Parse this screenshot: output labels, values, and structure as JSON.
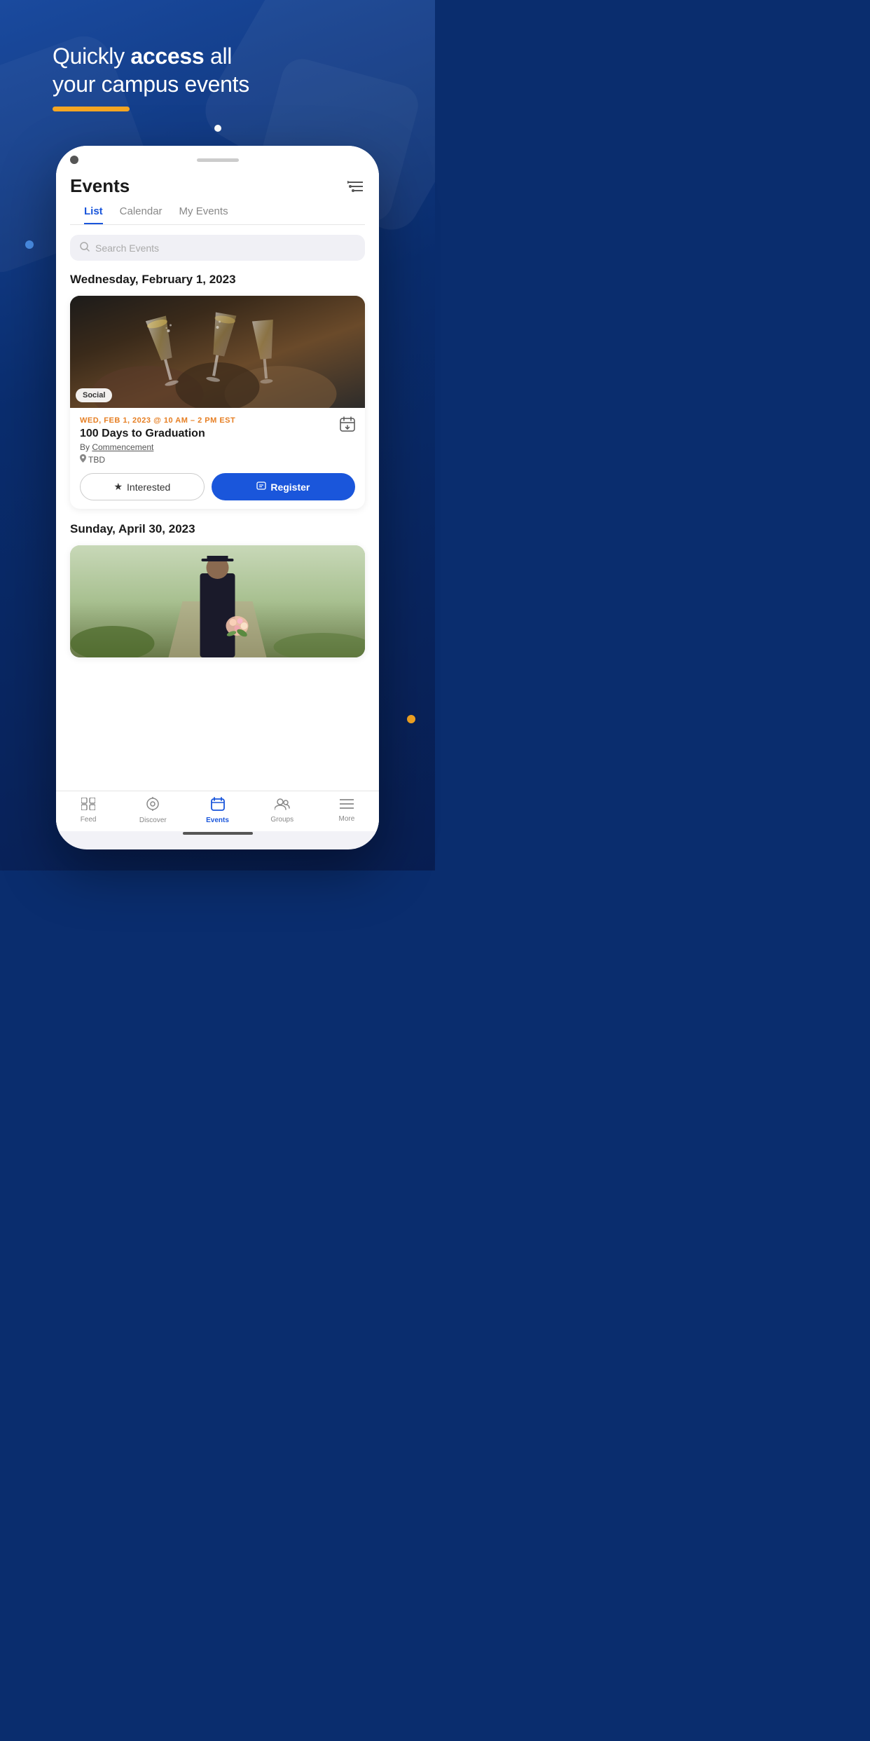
{
  "hero": {
    "title_normal": "Quickly ",
    "title_bold": "access",
    "title_end": " all your campus events",
    "underline_color": "#f5a623"
  },
  "tabs": {
    "list": "List",
    "calendar": "Calendar",
    "my_events": "My Events",
    "active": "list"
  },
  "search": {
    "placeholder": "Search Events"
  },
  "sections": [
    {
      "date": "Wednesday, February 1, 2023",
      "events": [
        {
          "badge": "Social",
          "date_label": "WED, FEB 1, 2023 @ 10 AM – 2 PM EST",
          "name": "100 Days to Graduation",
          "by": "By Commencement",
          "location": "TBD",
          "btn_interested": "Interested",
          "btn_register": "Register"
        }
      ]
    },
    {
      "date": "Sunday, April 30, 2023",
      "events": []
    }
  ],
  "bottom_nav": [
    {
      "icon": "feed",
      "label": "Feed",
      "active": false
    },
    {
      "icon": "discover",
      "label": "Discover",
      "active": false
    },
    {
      "icon": "events",
      "label": "Events",
      "active": true
    },
    {
      "icon": "groups",
      "label": "Groups",
      "active": false
    },
    {
      "icon": "more",
      "label": "More",
      "active": false
    }
  ],
  "filter_icon": "≡",
  "search_icon": "🔍",
  "star_icon": "★",
  "calendar_icon": "📅",
  "location_icon": "📍",
  "register_icon": "🎫"
}
